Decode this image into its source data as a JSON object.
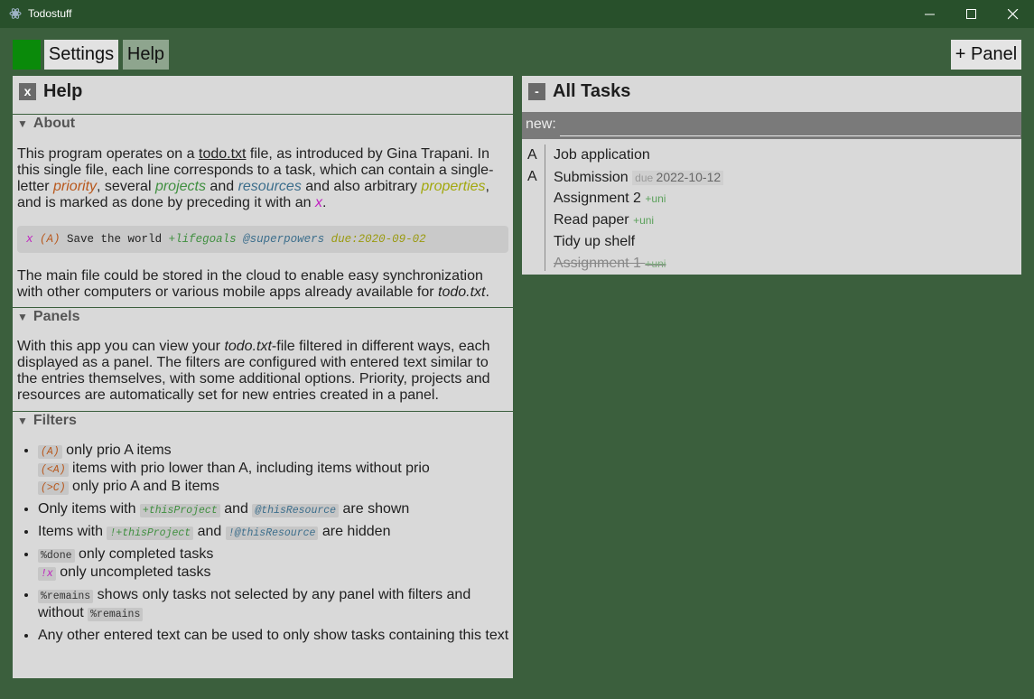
{
  "window": {
    "title": "Todostuff",
    "controls": [
      "minimize-icon",
      "maximize-icon",
      "close-icon"
    ]
  },
  "toolbar": {
    "settings_label": "Settings",
    "help_label": "Help",
    "add_panel_label": "+ Panel",
    "colors": {
      "green_button": "#0a8a0a",
      "active_tab": "#8ea58e",
      "background": "#3b5f3d"
    }
  },
  "help_panel": {
    "close_label": "x",
    "title": "Help",
    "about": {
      "heading": "About",
      "p1": {
        "a": "This program operates on a ",
        "todo_link": "todo.txt",
        "b": " file, as introduced by Gina Trapani. In this single file, each line corresponds to a task, which can contain a single-letter ",
        "priority": "priority",
        "c": ", several ",
        "projects": "projects",
        "d": " and ",
        "resources": "resources",
        "e": " and also arbitrary ",
        "properties": "properties",
        "f": ", and is marked as done by preceding it with an ",
        "x": "x",
        "g": "."
      },
      "example": {
        "x": "x",
        "prio": "(A)",
        "text": " Save the world ",
        "project": "+lifegoals",
        "resource": "@superpowers",
        "property": "due:2020-09-02"
      },
      "p2": {
        "a": "The main file could be stored in the cloud to enable easy synchronization with other computers or various mobile apps already available for ",
        "todo": "todo.txt",
        "b": "."
      }
    },
    "panels": {
      "heading": "Panels",
      "p": {
        "a": "With this app you can view your ",
        "todo": "todo.txt",
        "b": "-file filtered in different ways, each displayed as a panel. The filters are configured with entered text similar to the entries themselves, with some additional options. Priority, projects and resources are automatically set for new entries created in a panel."
      }
    },
    "filters": {
      "heading": "Filters",
      "items": [
        {
          "lines": [
            {
              "code": "(A)",
              "text": " only prio A items"
            },
            {
              "code": "(<A)",
              "text": " items with prio lower than A, including items without prio"
            },
            {
              "code": "(>C)",
              "text": " only prio A and B items"
            }
          ]
        },
        {
          "a": "Only items with ",
          "code1": "+thisProject",
          "b": " and ",
          "code2": "@thisResource",
          "c": " are shown"
        },
        {
          "a": "Items with ",
          "code1": "!+thisProject",
          "b": " and ",
          "code2": "!@thisResource",
          "c": " are hidden"
        },
        {
          "lines": [
            {
              "code": "%done",
              "text": " only completed tasks"
            },
            {
              "code": "!x",
              "text": " only uncompleted tasks"
            }
          ]
        },
        {
          "code1": "%remains",
          "a": " shows only tasks not selected by any panel with filters and without ",
          "code2": "%remains"
        },
        {
          "text": "Any other entered text can be used to only show tasks containing this text"
        }
      ]
    }
  },
  "tasks_panel": {
    "collapse_label": "-",
    "title": "All Tasks",
    "new_label": "new:",
    "new_value": "",
    "tasks": [
      {
        "prio": "A",
        "text": "Job application",
        "tag": "",
        "due_label": "",
        "due_date": "",
        "done": false
      },
      {
        "prio": "A",
        "text": "Submission",
        "tag": "",
        "due_label": "due",
        "due_date": "2022-10-12",
        "done": false
      },
      {
        "prio": "",
        "text": "Assignment 2",
        "tag": "+uni",
        "due_label": "",
        "due_date": "",
        "done": false
      },
      {
        "prio": "",
        "text": "Read paper",
        "tag": "+uni",
        "due_label": "",
        "due_date": "",
        "done": false
      },
      {
        "prio": "",
        "text": "Tidy up shelf",
        "tag": "",
        "due_label": "",
        "due_date": "",
        "done": false
      },
      {
        "prio": "",
        "text": "Assignment 1",
        "tag": "+uni",
        "due_label": "",
        "due_date": "",
        "done": true
      }
    ]
  }
}
